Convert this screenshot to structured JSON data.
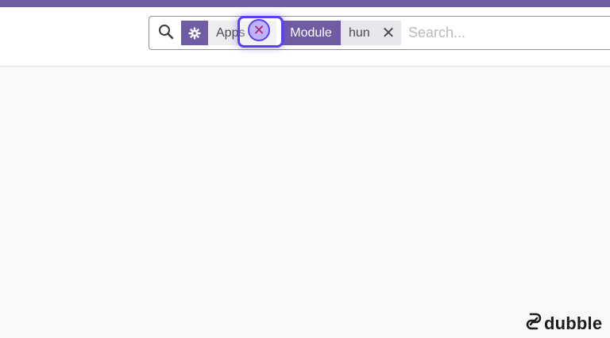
{
  "colors": {
    "accent": "#6f5ca3",
    "cursor_highlight": "#5b3ff0"
  },
  "search": {
    "placeholder": "Search...",
    "facets": [
      {
        "category_icon": "gear-icon",
        "value": "Apps",
        "remove_icon": "close-icon"
      },
      {
        "category": "Module",
        "value": "hun",
        "remove_icon": "close-icon"
      }
    ]
  },
  "click_marker": {
    "symbol": "✕"
  },
  "brand": {
    "name": "dubble",
    "icon": "dubble-logo-icon"
  }
}
